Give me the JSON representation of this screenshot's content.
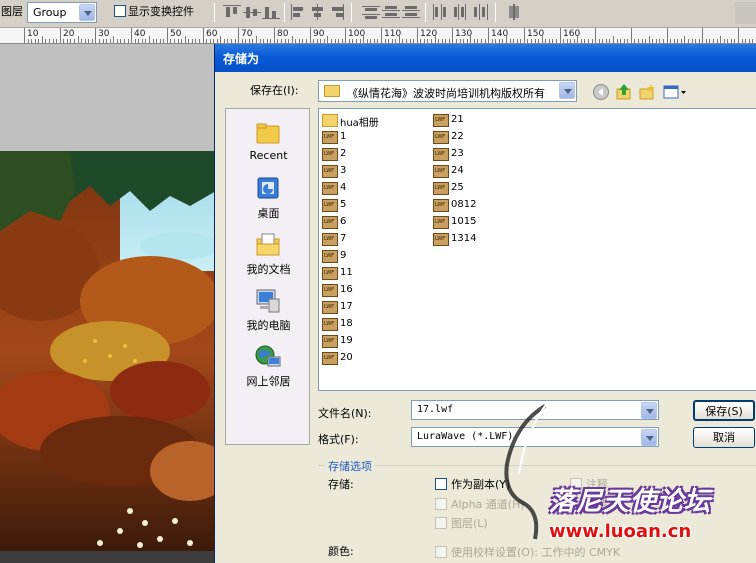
{
  "options_bar": {
    "layer_label": "图层",
    "group_value": "Group",
    "show_transform_label": "显示变换控件"
  },
  "ruler": {
    "ticks": [
      "10",
      "20",
      "30",
      "40",
      "50",
      "60",
      "70",
      "80",
      "90",
      "100",
      "110",
      "120",
      "130",
      "140",
      "150",
      "160"
    ]
  },
  "dialog": {
    "title": "存储为",
    "save_in_label": "保存在(I):",
    "save_in_value": "《纵情花海》波波时尚培训机构版权所有",
    "places": [
      {
        "label": "Recent",
        "icon": "recent-folder-icon"
      },
      {
        "label": "桌面",
        "icon": "desktop-icon"
      },
      {
        "label": "我的文档",
        "icon": "my-documents-icon"
      },
      {
        "label": "我的电脑",
        "icon": "my-computer-icon"
      },
      {
        "label": "网上邻居",
        "icon": "network-places-icon"
      }
    ],
    "files_col1": [
      "hua相册",
      "1",
      "2",
      "3",
      "4",
      "5",
      "6",
      "7",
      "9",
      "11",
      "16",
      "17",
      "18",
      "19",
      "20"
    ],
    "files_col2": [
      "21",
      "22",
      "23",
      "24",
      "25",
      "0812",
      "1015",
      "1314"
    ],
    "filename_label": "文件名(N):",
    "filename_value": "17.lwf",
    "format_label": "格式(F):",
    "format_value": "LuraWave (*.LWF)",
    "save_button": "保存(S)",
    "cancel_button": "取消",
    "options_title": "存储选项",
    "store_label": "存储:",
    "as_copy": "作为副本(Y)",
    "alpha": "Alpha 通道(H)",
    "layers": "图层(L)",
    "annotations": "注释",
    "spot": "专色",
    "color_label": "颜色:",
    "use_proof": "使用校样设置(O): 工作中的 CMYK"
  },
  "watermark": {
    "text": "落尼天使论坛",
    "url": "www.luoan.cn"
  }
}
